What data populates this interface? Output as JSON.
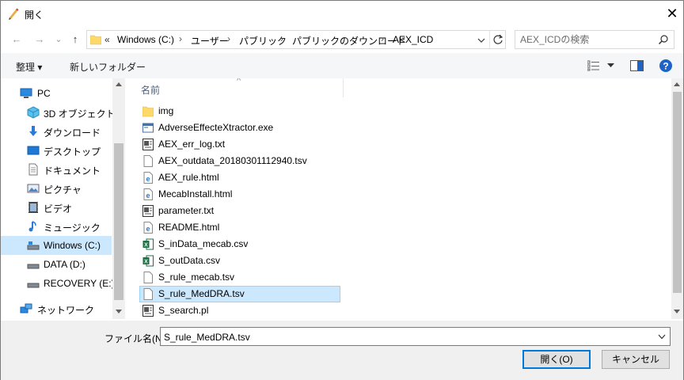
{
  "window": {
    "title": "開く",
    "close_glyph": "✕"
  },
  "nav_buttons": {
    "back": "←",
    "forward": "→",
    "dropdown": "⌄",
    "up": "↑"
  },
  "address": {
    "overflow": "«",
    "segments": [
      "Windows (C:)",
      "ユーザー",
      "パブリック",
      "パブリックのダウンロード",
      "AEX_ICD"
    ]
  },
  "search": {
    "placeholder": "AEX_ICDの検索"
  },
  "toolbar": {
    "organize_label": "整理 ▾",
    "new_folder_label": "新しいフォルダー"
  },
  "sidebar": {
    "items": [
      {
        "label": "PC",
        "icon": "computer-icon"
      },
      {
        "label": "3D オブジェクト",
        "icon": "cube-icon"
      },
      {
        "label": "ダウンロード",
        "icon": "download-icon"
      },
      {
        "label": "デスクトップ",
        "icon": "desktop-icon"
      },
      {
        "label": "ドキュメント",
        "icon": "document-icon"
      },
      {
        "label": "ピクチャ",
        "icon": "picture-icon"
      },
      {
        "label": "ビデオ",
        "icon": "video-icon"
      },
      {
        "label": "ミュージック",
        "icon": "music-icon"
      },
      {
        "label": "Windows (C:)",
        "icon": "drive-icon"
      },
      {
        "label": "DATA (D:)",
        "icon": "drive-icon"
      },
      {
        "label": "RECOVERY (E:)",
        "icon": "drive-icon"
      },
      {
        "label": "ネットワーク",
        "icon": "network-icon"
      }
    ]
  },
  "list": {
    "column_header": "名前",
    "sort_indicator": "^",
    "files": [
      {
        "name": "img",
        "icon": "folder-icon"
      },
      {
        "name": "AdverseEffecteXtractor.exe",
        "icon": "exe-icon"
      },
      {
        "name": "AEX_err_log.txt",
        "icon": "text-file-icon"
      },
      {
        "name": "AEX_outdata_20180301112940.tsv",
        "icon": "blank-file-icon"
      },
      {
        "name": "AEX_rule.html",
        "icon": "html-file-icon"
      },
      {
        "name": "MecabInstall.html",
        "icon": "html-file-icon"
      },
      {
        "name": "parameter.txt",
        "icon": "text-file-icon"
      },
      {
        "name": "README.html",
        "icon": "html-file-icon"
      },
      {
        "name": "S_inData_mecab.csv",
        "icon": "excel-file-icon"
      },
      {
        "name": "S_outData.csv",
        "icon": "excel-file-icon"
      },
      {
        "name": "S_rule_mecab.tsv",
        "icon": "blank-file-icon"
      },
      {
        "name": "S_rule_MedDRA.tsv",
        "icon": "blank-file-icon"
      },
      {
        "name": "S_search.pl",
        "icon": "text-file-icon"
      }
    ]
  },
  "footer": {
    "filename_label": "ファイル名(N):",
    "filename_value": "S_rule_MedDRA.tsv",
    "open_label": "開く(O)",
    "cancel_label": "キャンセル"
  },
  "colors": {
    "accent": "#0078d7",
    "selection": "#cce8ff",
    "help": "#1e64c8"
  }
}
